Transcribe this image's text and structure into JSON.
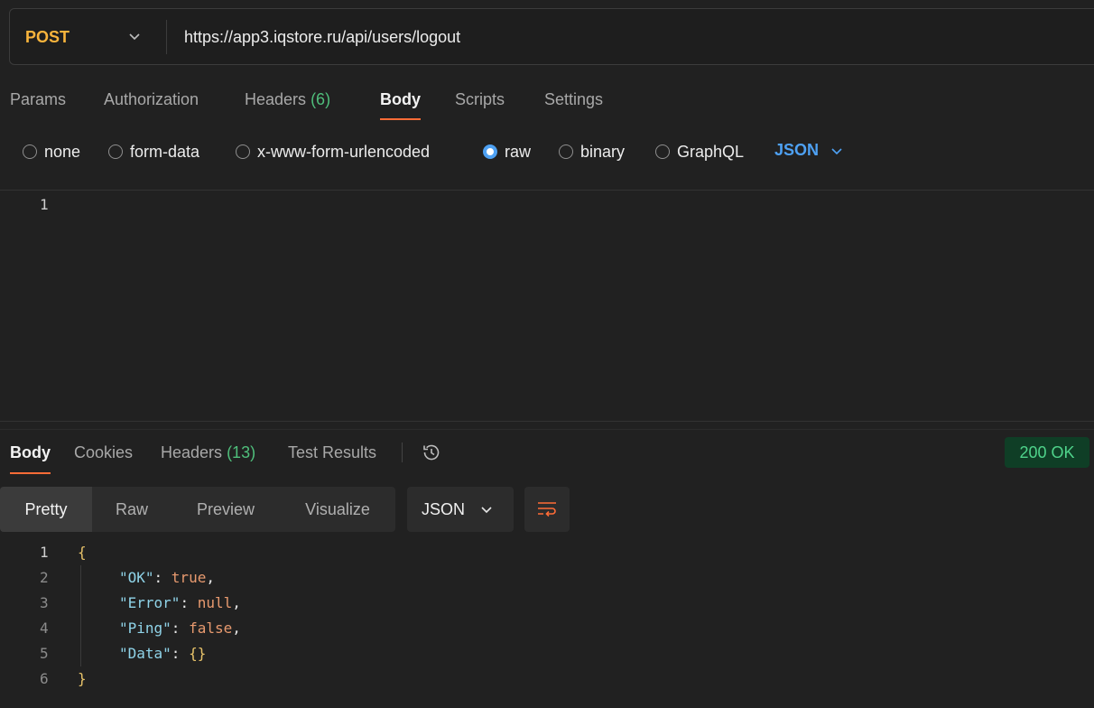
{
  "request": {
    "method": "POST",
    "url": "https://app3.iqstore.ru/api/users/logout",
    "tabs": {
      "params": "Params",
      "authorization": "Authorization",
      "headers": "Headers",
      "headers_count": "(6)",
      "body": "Body",
      "scripts": "Scripts",
      "settings": "Settings"
    },
    "body_options": {
      "none": "none",
      "form_data": "form-data",
      "urlencoded": "x-www-form-urlencoded",
      "raw": "raw",
      "binary": "binary",
      "graphql": "GraphQL",
      "selected": "raw",
      "format": "JSON"
    },
    "editor": {
      "line_number": "1"
    }
  },
  "response": {
    "tabs": {
      "body": "Body",
      "cookies": "Cookies",
      "headers": "Headers",
      "headers_count": "(13)",
      "test_results": "Test Results"
    },
    "status": "200 OK",
    "view_modes": {
      "pretty": "Pretty",
      "raw": "Raw",
      "preview": "Preview",
      "visualize": "Visualize"
    },
    "format": "JSON",
    "lines": [
      {
        "n": "1",
        "open": "{"
      },
      {
        "n": "2",
        "key": "\"OK\"",
        "colon": ": ",
        "value": "true",
        "comma": ","
      },
      {
        "n": "3",
        "key": "\"Error\"",
        "colon": ": ",
        "value": "null",
        "comma": ","
      },
      {
        "n": "4",
        "key": "\"Ping\"",
        "colon": ": ",
        "value": "false",
        "comma": ","
      },
      {
        "n": "5",
        "key": "\"Data\"",
        "colon": ": ",
        "value": "{}",
        "comma": ""
      },
      {
        "n": "6",
        "close": "}"
      }
    ]
  },
  "icons": [
    "chevron-down-icon",
    "history-icon",
    "wrap-lines-icon"
  ],
  "colors": {
    "accent_orange": "#ff6c37",
    "method_post": "#f9b43c",
    "link_blue": "#4ea1f3",
    "count_green": "#4fbe7b",
    "status_ok": "#4fd38b"
  }
}
